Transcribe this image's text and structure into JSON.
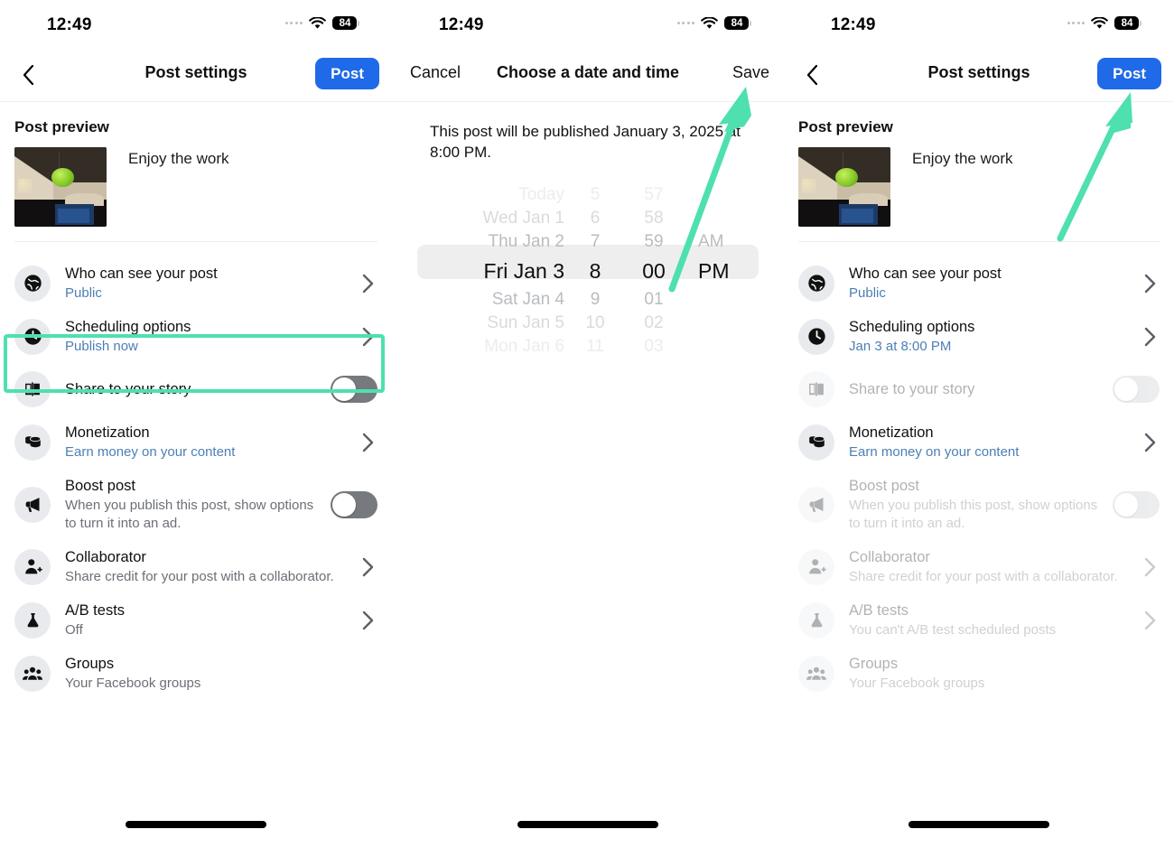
{
  "status_bar": {
    "time": "12:49",
    "battery": "84",
    "wifi_icon": "wifi-icon",
    "cellular_icon": "cellular-dots-icon"
  },
  "colors": {
    "accent_blue": "#1f6ae8",
    "link_blue": "#4c7fb5",
    "highlight_green": "#4ee0ae",
    "toggle_off": "#76797d"
  },
  "panel1": {
    "nav": {
      "back_icon": "chevron-left-icon",
      "title": "Post settings",
      "post_label": "Post"
    },
    "preview": {
      "heading": "Post preview",
      "caption": "Enjoy the work"
    },
    "rows": [
      {
        "icon": "globe-icon",
        "title": "Who can see your post",
        "sub": "Public",
        "sub_style": "link",
        "control": "chevron"
      },
      {
        "icon": "clock-icon",
        "title": "Scheduling options",
        "sub": "Publish now",
        "sub_style": "link",
        "control": "chevron"
      },
      {
        "icon": "book-icon",
        "title": "Share to your story",
        "sub": "",
        "sub_style": "none",
        "control": "toggle"
      },
      {
        "icon": "coins-icon",
        "title": "Monetization",
        "sub": "Earn money on your content",
        "sub_style": "link",
        "control": "chevron"
      },
      {
        "icon": "megaphone-icon",
        "title": "Boost post",
        "sub": "When you publish this post, show options to turn it into an ad.",
        "sub_style": "muted",
        "control": "toggle"
      },
      {
        "icon": "person-add-icon",
        "title": "Collaborator",
        "sub": "Share credit for your post with a collaborator.",
        "sub_style": "muted",
        "control": "chevron"
      },
      {
        "icon": "flask-icon",
        "title": "A/B tests",
        "sub": "Off",
        "sub_style": "muted",
        "control": "chevron"
      },
      {
        "icon": "people-icon",
        "title": "Groups",
        "sub": "Your Facebook groups",
        "sub_style": "muted",
        "control": "none"
      }
    ]
  },
  "panel2": {
    "nav": {
      "cancel_label": "Cancel",
      "title": "Choose a date and time",
      "save_label": "Save"
    },
    "note": "This post will be published January 3, 2025 at 8:00 PM.",
    "picker": {
      "dates": [
        "Today",
        "Wed Jan 1",
        "Thu Jan 2",
        "Fri Jan 3",
        "Sat Jan 4",
        "Sun Jan 5",
        "Mon Jan 6"
      ],
      "hours": [
        "5",
        "6",
        "7",
        "8",
        "9",
        "10",
        "11"
      ],
      "minutes": [
        "57",
        "58",
        "59",
        "00",
        "01",
        "02",
        "03"
      ],
      "ampm": [
        "",
        "",
        "AM",
        "PM",
        "",
        "",
        ""
      ],
      "selected_index": 3,
      "selected_date": "Fri Jan 3",
      "selected_hour": "8",
      "selected_minute": "00",
      "selected_ampm": "PM"
    }
  },
  "panel3": {
    "nav": {
      "back_icon": "chevron-left-icon",
      "title": "Post settings",
      "post_label": "Post"
    },
    "preview": {
      "heading": "Post preview",
      "caption": "Enjoy the work"
    },
    "rows": [
      {
        "icon": "globe-icon",
        "title": "Who can see your post",
        "sub": "Public",
        "sub_style": "link",
        "control": "chevron",
        "disabled": false
      },
      {
        "icon": "clock-icon",
        "title": "Scheduling options",
        "sub": "Jan 3 at 8:00 PM",
        "sub_style": "link",
        "control": "chevron",
        "disabled": false
      },
      {
        "icon": "book-icon",
        "title": "Share to your story",
        "sub": "",
        "sub_style": "none",
        "control": "toggle",
        "disabled": true
      },
      {
        "icon": "coins-icon",
        "title": "Monetization",
        "sub": "Earn money on your content",
        "sub_style": "link",
        "control": "chevron",
        "disabled": false
      },
      {
        "icon": "megaphone-icon",
        "title": "Boost post",
        "sub": "When you publish this post, show options to turn it into an ad.",
        "sub_style": "muted",
        "control": "toggle",
        "disabled": true
      },
      {
        "icon": "person-add-icon",
        "title": "Collaborator",
        "sub": "Share credit for your post with a collaborator.",
        "sub_style": "muted",
        "control": "chevron",
        "disabled": true
      },
      {
        "icon": "flask-icon",
        "title": "A/B tests",
        "sub": "You can't A/B test scheduled posts",
        "sub_style": "muted",
        "control": "chevron",
        "disabled": true
      },
      {
        "icon": "people-icon",
        "title": "Groups",
        "sub": "Your Facebook groups",
        "sub_style": "muted",
        "control": "none",
        "disabled": true
      }
    ]
  },
  "annotations": {
    "highlight_target": "Scheduling options",
    "arrow_2_target": "Save",
    "arrow_3_target": "Post"
  }
}
